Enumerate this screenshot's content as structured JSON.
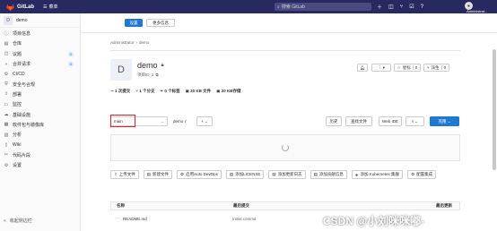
{
  "topbar": {
    "brand": "GitLab",
    "menu": "菜单",
    "search_placeholder": "搜索 GitLab",
    "icons": [
      "plus-icon",
      "issues-icon",
      "merge-icon",
      "todo-icon",
      "help-icon"
    ],
    "admin": "Administrat..."
  },
  "sidebar": {
    "project_initial": "D",
    "project_name": "demo",
    "items": [
      {
        "label": "项目信息",
        "icon": "info-icon"
      },
      {
        "label": "仓库",
        "icon": "repo-icon"
      },
      {
        "label": "议题",
        "icon": "issues-icon",
        "count": "0"
      },
      {
        "label": "合并请求",
        "icon": "merge-icon",
        "count": "0"
      },
      {
        "label": "CI/CD",
        "icon": "rocket-icon"
      },
      {
        "label": "安全与合规",
        "icon": "shield-icon"
      },
      {
        "label": "部署",
        "icon": "deploy-icon"
      },
      {
        "label": "监控",
        "icon": "monitor-icon"
      },
      {
        "label": "基础设施",
        "icon": "cloud-icon"
      },
      {
        "label": "软件包与镜像库",
        "icon": "package-icon"
      },
      {
        "label": "分析",
        "icon": "chart-icon"
      },
      {
        "label": "Wiki",
        "icon": "book-icon"
      },
      {
        "label": "代码片段",
        "icon": "snippet-icon"
      },
      {
        "label": "设置",
        "icon": "gear-icon"
      }
    ],
    "collapse": "收起侧边栏"
  },
  "banner": {
    "settings": "设置",
    "more": "更多信息"
  },
  "breadcrumb": {
    "root": "Administrator",
    "sep": "›",
    "current": "demo"
  },
  "project": {
    "initial": "D",
    "name": "demo",
    "id": "项目ID: 2",
    "star_label": "星标",
    "star_count": "0",
    "fork_label": "派生",
    "fork_count": "0"
  },
  "stats": {
    "commits": "1 次提交",
    "branches": "1 个分支",
    "tags": "0 个标签",
    "files": "20 KB 文件",
    "storage": "20 KB存储"
  },
  "repo_toolbar": {
    "branch": "main",
    "path": "demo",
    "path_sep": "/",
    "add": "+",
    "history": "历史",
    "find_file": "查找文件",
    "web_ide": "Web IDE",
    "download": "⭳",
    "clone": "克隆"
  },
  "quick_actions": [
    "上传文件",
    "新建文件",
    "启用Auto DevOps",
    "添加LICENSE",
    "添加更新日志",
    "添加贡献信息",
    "添加 Kubernetes 集群",
    "配置集成"
  ],
  "table": {
    "headers": [
      "名称",
      "最后提交",
      "最后更新"
    ],
    "rows": [
      {
        "name": "README.md",
        "commit": "Initial commit",
        "updated": ""
      }
    ]
  },
  "watermark": "CSDN @小刘咪咪嘟-"
}
